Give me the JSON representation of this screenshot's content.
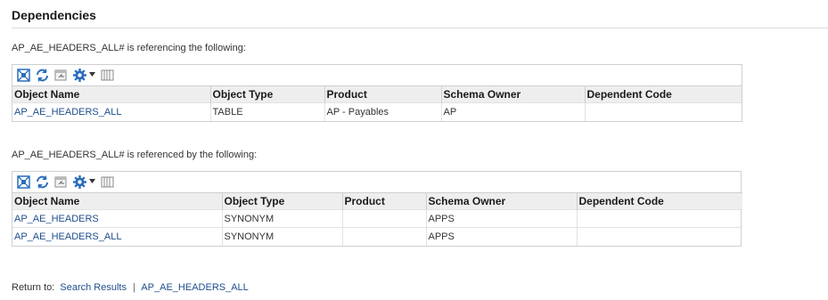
{
  "section": {
    "title": "Dependencies"
  },
  "referencing": {
    "caption": "AP_AE_HEADERS_ALL# is referencing the following:",
    "columns": [
      "Object Name",
      "Object Type",
      "Product",
      "Schema Owner",
      "Dependent Code"
    ],
    "rows": [
      {
        "object_name": "AP_AE_HEADERS_ALL",
        "object_type": "TABLE",
        "product": "AP - Payables",
        "schema_owner": "AP",
        "dependent_code": ""
      }
    ]
  },
  "referenced_by": {
    "caption": "AP_AE_HEADERS_ALL# is referenced by the following:",
    "columns": [
      "Object Name",
      "Object Type",
      "Product",
      "Schema Owner",
      "Dependent Code"
    ],
    "rows": [
      {
        "object_name": "AP_AE_HEADERS",
        "object_type": "SYNONYM",
        "product": "",
        "schema_owner": "APPS",
        "dependent_code": ""
      },
      {
        "object_name": "AP_AE_HEADERS_ALL",
        "object_type": "SYNONYM",
        "product": "",
        "schema_owner": "APPS",
        "dependent_code": ""
      }
    ]
  },
  "toolbar_icons": [
    "detach-icon",
    "refresh-icon",
    "export-icon",
    "gear-icon",
    "columns-icon"
  ],
  "return_to": {
    "label": "Return to:",
    "links": [
      "Search Results",
      "AP_AE_HEADERS_ALL"
    ],
    "separator": "|"
  },
  "colors": {
    "link": "#1f4e8c",
    "header_bg": "#eeeeee",
    "icon_blue": "#2a6ebb"
  }
}
